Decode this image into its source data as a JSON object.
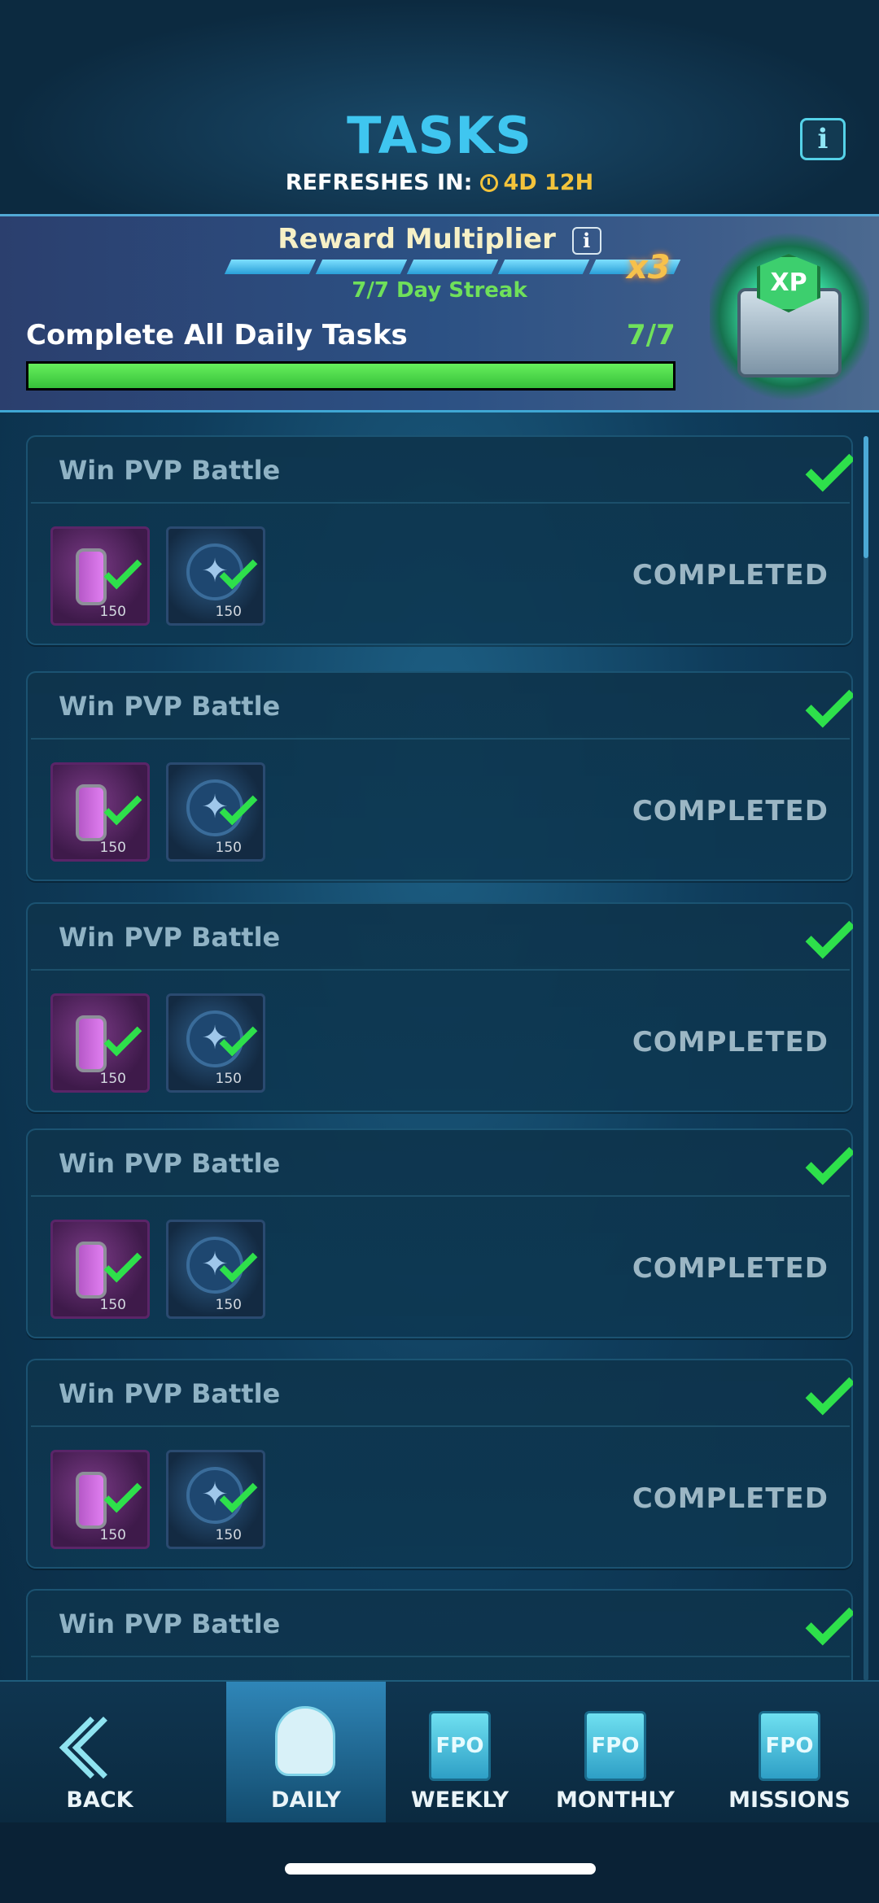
{
  "header": {
    "title": "TASKS",
    "refresh_label": "REFRESHES IN:",
    "refresh_time": "4D 12H",
    "info_label": "i"
  },
  "banner": {
    "title": "Reward Multiplier",
    "info_label": "i",
    "multiplier": "x3",
    "streak_text": "7/7 Day Streak",
    "streak_segments_filled": 5,
    "complete_label": "Complete All Daily Tasks",
    "complete_count": "7/7",
    "progress": 1.0,
    "chest_badge": "XP"
  },
  "tasks": [
    {
      "name": "Win PVP Battle",
      "status": "COMPLETED",
      "rewards": [
        {
          "type": "fuel-capsule",
          "amount": "150"
        },
        {
          "type": "star-coin",
          "amount": "150"
        }
      ]
    },
    {
      "name": "Win PVP Battle",
      "status": "COMPLETED",
      "rewards": [
        {
          "type": "fuel-capsule",
          "amount": "150"
        },
        {
          "type": "star-coin",
          "amount": "150"
        }
      ]
    },
    {
      "name": "Win PVP Battle",
      "status": "COMPLETED",
      "rewards": [
        {
          "type": "fuel-capsule",
          "amount": "150"
        },
        {
          "type": "star-coin",
          "amount": "150"
        }
      ]
    },
    {
      "name": "Win PVP Battle",
      "status": "COMPLETED",
      "rewards": [
        {
          "type": "fuel-capsule",
          "amount": "150"
        },
        {
          "type": "star-coin",
          "amount": "150"
        }
      ]
    },
    {
      "name": "Win PVP Battle",
      "status": "COMPLETED",
      "rewards": [
        {
          "type": "fuel-capsule",
          "amount": "150"
        },
        {
          "type": "star-coin",
          "amount": "150"
        }
      ]
    },
    {
      "name": "Win PVP Battle",
      "status": "",
      "rewards": []
    }
  ],
  "nav": {
    "back": "BACK",
    "daily": "DAILY",
    "weekly": "WEEKLY",
    "monthly": "MONTHLY",
    "missions": "MISSIONS",
    "placeholder_icon_text": "FPO"
  },
  "colors": {
    "title": "#3fc6f0",
    "time": "#f3c33b",
    "check": "#2ee04b",
    "progress": "#4fdc4b"
  }
}
